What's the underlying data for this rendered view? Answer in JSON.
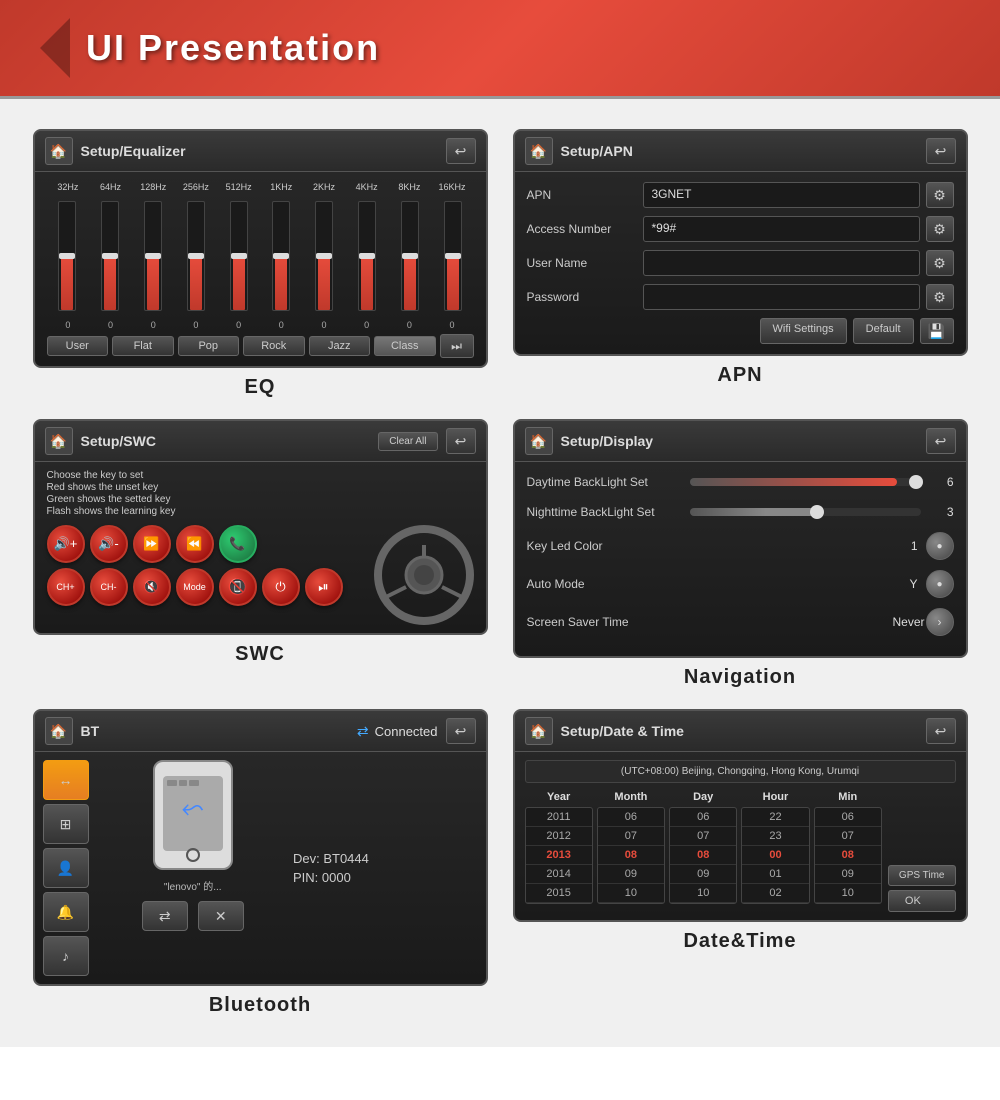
{
  "header": {
    "title": "UI Presentation"
  },
  "eq_panel": {
    "title": "Setup/Equalizer",
    "frequencies": [
      "32Hz",
      "64Hz",
      "128Hz",
      "256Hz",
      "512Hz",
      "1KHz",
      "2KHz",
      "4KHz",
      "8KHz",
      "16KHz"
    ],
    "values": [
      0,
      0,
      0,
      0,
      0,
      0,
      0,
      0,
      0,
      0
    ],
    "slider_heights": [
      50,
      50,
      50,
      50,
      50,
      50,
      50,
      50,
      50,
      50
    ],
    "presets": [
      "User",
      "Flat",
      "Pop",
      "Rock",
      "Jazz",
      "Class"
    ],
    "label": "EQ"
  },
  "apn_panel": {
    "title": "Setup/APN",
    "fields": [
      {
        "label": "APN",
        "value": "3GNET"
      },
      {
        "label": "Access Number",
        "value": "*99#"
      },
      {
        "label": "User Name",
        "value": ""
      },
      {
        "label": "Password",
        "value": ""
      }
    ],
    "buttons": {
      "wifi_settings": "Wifi Settings",
      "default": "Default",
      "save": "💾"
    },
    "label": "APN"
  },
  "swc_panel": {
    "title": "Setup/SWC",
    "clear_all": "Clear All",
    "instructions": [
      "Choose the key to set",
      "Red shows the unset key",
      "Green shows the setted key",
      "Flash shows the learning key"
    ],
    "label": "SWC"
  },
  "display_panel": {
    "title": "Setup/Display",
    "rows": [
      {
        "label": "Daytime BackLight Set",
        "value": "6",
        "type": "slider_day"
      },
      {
        "label": "Nighttime BackLight Set",
        "value": "3",
        "type": "slider_night"
      },
      {
        "label": "Key Led Color",
        "value": "1",
        "type": "toggle"
      },
      {
        "label": "Auto Mode",
        "value": "Y",
        "type": "toggle"
      },
      {
        "label": "Screen Saver Time",
        "value": "Never",
        "type": "arrow"
      }
    ],
    "label": "Navigation"
  },
  "bt_panel": {
    "title": "BT",
    "connected_text": "Connected",
    "dev_label": "Dev: BT0444",
    "pin_label": "PIN: 0000",
    "phone_label": "\"lenovo\" 的...",
    "label": "Bluetooth"
  },
  "dt_panel": {
    "title": "Setup/Date & Time",
    "timezone": "(UTC+08:00) Beijing, Chongqing, Hong Kong, Urumqi",
    "columns": [
      "Year",
      "Month",
      "Day",
      "Hour",
      "Min"
    ],
    "col_values": {
      "Year": [
        "2011",
        "2012",
        "2013",
        "2014",
        "2015"
      ],
      "Month": [
        "06",
        "07",
        "08",
        "09",
        "10"
      ],
      "Day": [
        "06",
        "07",
        "08",
        "09",
        "10"
      ],
      "Hour": [
        "22",
        "23",
        "00",
        "01",
        "02"
      ],
      "Min": [
        "06",
        "07",
        "08",
        "09",
        "10"
      ]
    },
    "active_row": 2,
    "active_year": "2013",
    "active_month": "08",
    "active_day": "08",
    "active_hour": "00",
    "active_min": "08",
    "gps_time_btn": "GPS Time",
    "ok_btn": "OK",
    "label": "Date&Time"
  }
}
